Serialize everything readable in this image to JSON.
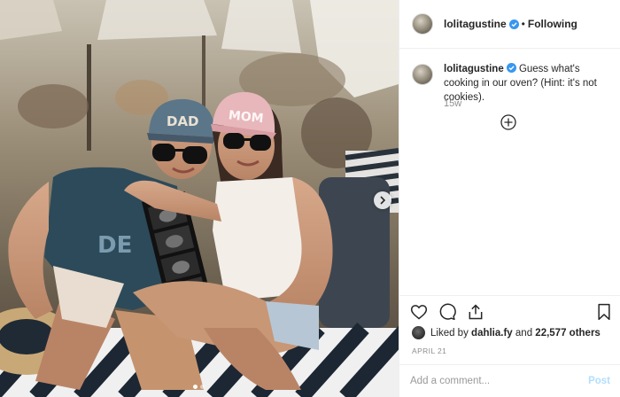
{
  "post": {
    "username": "lolitagustine",
    "follow_separator": "•",
    "follow_label": "Following",
    "caption_text": "Guess what's cooking in our oven? (Hint: it's not cookies).",
    "time_ago": "15w",
    "likes_prefix": "Liked by",
    "likes_user": "dahlia.fy",
    "likes_and": "and",
    "likes_count": "22,577 others",
    "date": "APRIL 21"
  },
  "photo": {
    "cap_left_text": "DAD",
    "cap_right_text": "MOM",
    "carousel_dots": 2,
    "carousel_active": 0
  },
  "comment": {
    "placeholder": "Add a comment...",
    "post_label": "Post"
  },
  "colors": {
    "verified": "#3897f0",
    "link_muted": "#b2dffc",
    "divider": "#efefef"
  },
  "icons": {
    "like": "heart-icon",
    "comment": "comment-icon",
    "share": "share-icon",
    "save": "bookmark-icon",
    "expand": "plus-circle-icon",
    "next": "chevron-right-icon",
    "verified": "verified-badge-icon"
  }
}
